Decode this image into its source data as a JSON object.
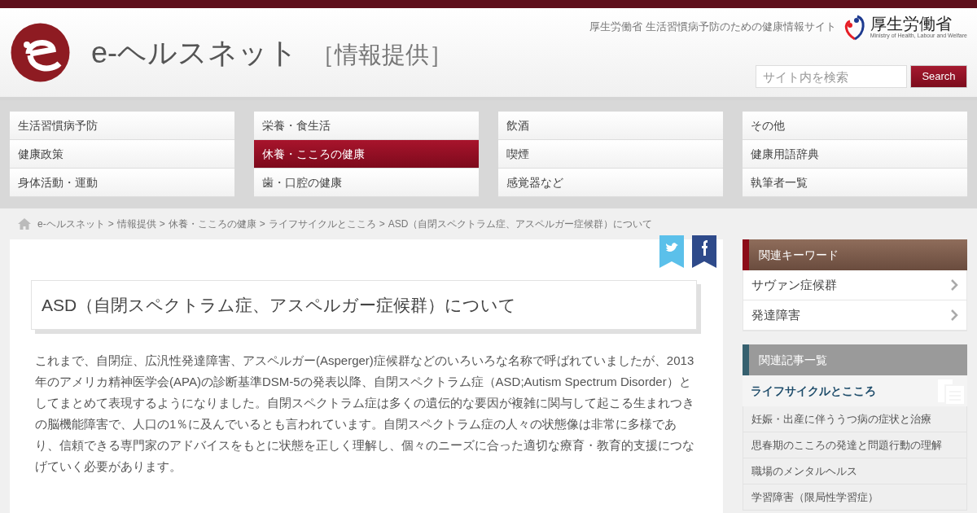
{
  "header": {
    "site_name": "e-ヘルスネット",
    "section": "［情報提供］",
    "tagline": "厚生労働省 生活習慣病予防のための健康情報サイト",
    "ministry_name": "厚生労働省",
    "ministry_english": "Ministry of Health, Labour and Welfare",
    "search": {
      "placeholder": "サイト内を検索",
      "button": "Search"
    }
  },
  "nav": [
    [
      {
        "label": "生活習慣病予防",
        "selected": false
      },
      {
        "label": "健康政策",
        "selected": false
      },
      {
        "label": "身体活動・運動",
        "selected": false
      }
    ],
    [
      {
        "label": "栄養・食生活",
        "selected": false
      },
      {
        "label": "休養・こころの健康",
        "selected": true
      },
      {
        "label": "歯・口腔の健康",
        "selected": false
      }
    ],
    [
      {
        "label": "飲酒",
        "selected": false
      },
      {
        "label": "喫煙",
        "selected": false
      },
      {
        "label": "感覚器など",
        "selected": false
      }
    ],
    [
      {
        "label": "その他",
        "selected": false
      },
      {
        "label": "健康用語辞典",
        "selected": false
      },
      {
        "label": "執筆者一覧",
        "selected": false
      }
    ]
  ],
  "breadcrumb": {
    "separator": ">",
    "items": [
      "e-ヘルスネット",
      "情報提供",
      "休養・こころの健康",
      "ライフサイクルとこころ",
      "ASD（自閉スペクトラム症、アスペルガー症候群）について"
    ]
  },
  "article": {
    "title": "ASD（自閉スペクトラム症、アスペルガー症候群）について",
    "body": "これまで、自閉症、広汎性発達障害、アスペルガー(Asperger)症候群などのいろいろな名称で呼ばれていましたが、2013年のアメリカ精神医学会(APA)の診断基準DSM-5の発表以降、自閉スペクトラム症（ASD;Autism Spectrum Disorder）としてまとめて表現するようになりました。自閉スペクトラム症は多くの遺伝的な要因が複雑に関与して起こる生まれつきの脳機能障害で、人口の1％に及んでいるとも言われています。自閉スペクトラム症の人々の状態像は非常に多様であり、信頼できる専門家のアドバイスをもとに状態を正しく理解し、個々のニーズに合った適切な療育・教育的支援につなげていく必要があります。"
  },
  "sidebar": {
    "keywords": {
      "title": "関連キーワード",
      "items": [
        "サヴァン症候群",
        "発達障害"
      ]
    },
    "related": {
      "title": "関連記事一覧",
      "category": "ライフサイクルとこころ",
      "items": [
        "妊娠・出産に伴ううつ病の症状と治療",
        "思春期のこころの発達と問題行動の理解",
        "職場のメンタルヘルス",
        "学習障害（限局性学習症）"
      ]
    }
  }
}
